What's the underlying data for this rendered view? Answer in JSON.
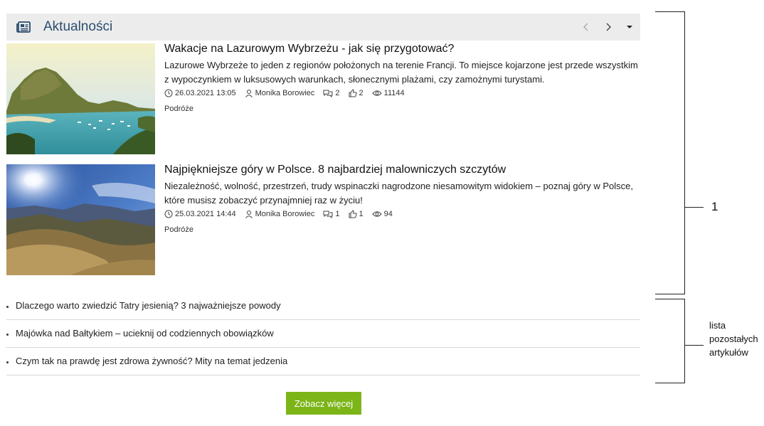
{
  "widget": {
    "title": "Aktualności",
    "icons": {
      "header": "newspaper-icon",
      "prev": "chevron-left-icon",
      "next": "chevron-right-icon",
      "menu": "caret-down-icon"
    }
  },
  "articles": [
    {
      "title": "Wakacje na Lazurowym Wybrzeżu - jak się przygotować?",
      "description": "Lazurowe Wybrzeże to jeden z regionów położonych na terenie Francji. To miejsce kojarzone jest przede wszystkim z wypoczynkiem w luksusowych warunkach, słonecznymi plażami, czy zamożnymi turystami.",
      "date": "26.03.2021 13:05",
      "author": "Monika Borowiec",
      "comments": "2",
      "likes": "2",
      "views": "11144",
      "category": "Podróże",
      "image": "coastal-bay-photo"
    },
    {
      "title": "Najpiękniejsze góry w Polsce. 8 najbardziej malowniczych szczytów",
      "description": "Niezależność, wolność, przestrzeń, trudy wspinaczki nagrodzone niesamowitym widokiem – poznaj góry w Polsce, które musisz zobaczyć przynajmniej raz w życiu!",
      "date": "25.03.2021 14:44",
      "author": "Monika Borowiec",
      "comments": "1",
      "likes": "1",
      "views": "94",
      "category": "Podróże",
      "image": "mountain-sunburst-photo"
    }
  ],
  "other_articles": [
    "Dlaczego warto zwiedzić Tatry jesienią? 3 najważniejsze powody",
    "Majówka nad Bałtykiem – ucieknij od codziennych obowiązków",
    "Czym tak na prawdę jest zdrowa żywność? Mity na temat jedzenia"
  ],
  "more_button": "Zobacz więcej",
  "annotations": {
    "marker_1": "1",
    "list_label": "lista pozostałych artykułów"
  }
}
